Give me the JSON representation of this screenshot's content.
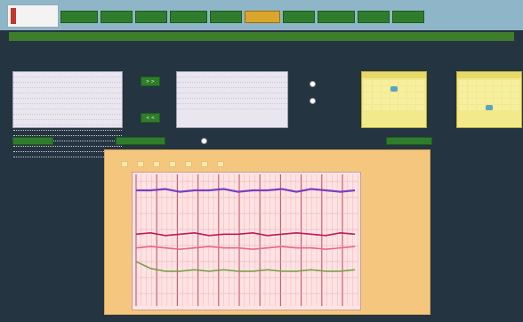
{
  "logo": {
    "line1": "",
    "line2": "",
    "line3": ""
  },
  "nav": {
    "tabs": [
      {
        "label": ""
      },
      {
        "label": ""
      },
      {
        "label": ""
      },
      {
        "label": ""
      },
      {
        "label": ""
      },
      {
        "label": "",
        "active": true
      },
      {
        "label": ""
      },
      {
        "label": ""
      },
      {
        "label": ""
      },
      {
        "label": ""
      }
    ]
  },
  "banner": "",
  "left_panel": {
    "title": "",
    "items": [
      "",
      "",
      "",
      "",
      "",
      "",
      "",
      "",
      "",
      "",
      "",
      "",
      "",
      "",
      "",
      ""
    ]
  },
  "right_panel": {
    "title": "",
    "items": [
      "",
      "",
      "",
      "",
      "",
      "",
      ""
    ]
  },
  "move_buttons": {
    "add": "> >",
    "remove": "< <"
  },
  "radios": [
    {
      "label": ""
    },
    {
      "label": ""
    }
  ],
  "calendars": [
    {
      "title": "",
      "subtitle": "",
      "selected_index": 10
    },
    {
      "title": "",
      "subtitle": "",
      "selected_index": 31
    }
  ],
  "actions": {
    "left_btn": "",
    "small_text": "",
    "middle_btn": "",
    "check_label": "",
    "right_btn": ""
  },
  "chart": {
    "title": "",
    "legend": [
      "",
      "",
      "",
      "",
      "",
      "",
      ""
    ]
  },
  "chart_data": {
    "type": "line",
    "title": "",
    "series": [
      {
        "color": "#7b3fc0",
        "values": [
          0.13,
          0.13,
          0.12,
          0.14,
          0.13,
          0.13,
          0.12,
          0.14,
          0.13,
          0.13,
          0.12,
          0.14,
          0.12,
          0.13,
          0.14,
          0.13
        ]
      },
      {
        "color": "#c0185a",
        "values": [
          0.45,
          0.44,
          0.46,
          0.45,
          0.44,
          0.46,
          0.45,
          0.45,
          0.44,
          0.46,
          0.45,
          0.44,
          0.45,
          0.46,
          0.44,
          0.45
        ]
      },
      {
        "color": "#e26a8f",
        "values": [
          0.55,
          0.54,
          0.55,
          0.56,
          0.55,
          0.54,
          0.55,
          0.55,
          0.56,
          0.55,
          0.54,
          0.55,
          0.55,
          0.56,
          0.55,
          0.54
        ]
      },
      {
        "color": "#7aa04a",
        "values": [
          0.65,
          0.7,
          0.72,
          0.72,
          0.71,
          0.72,
          0.71,
          0.72,
          0.72,
          0.71,
          0.72,
          0.72,
          0.71,
          0.72,
          0.72,
          0.71
        ]
      }
    ],
    "grid": true,
    "legend_position": "top"
  },
  "colors": {
    "accent": "#2f7d2c",
    "active_tab": "#d9a52a",
    "chart_bg": "#f5c77e"
  }
}
